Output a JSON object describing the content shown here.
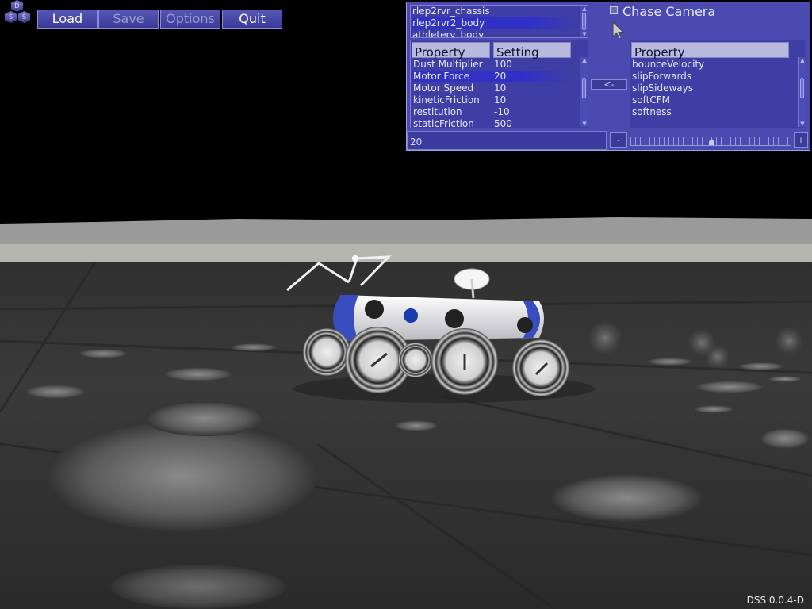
{
  "logo": {
    "letters": [
      "D",
      "S",
      "S"
    ]
  },
  "toolbar": {
    "load": "Load",
    "save": "Save",
    "options": "Options",
    "quit": "Quit"
  },
  "panel": {
    "objects": [
      "rlep2rvr_chassis",
      "rlep2rvr2_body",
      "athleterv_body"
    ],
    "selected_object": "rlep2rvr2_body",
    "chase_camera_label": "Chase Camera",
    "chase_camera_checked": false,
    "left_headers": {
      "property": "Property",
      "setting": "Setting"
    },
    "properties": [
      {
        "name": "Dust Multiplier",
        "value": "100"
      },
      {
        "name": "Motor Force",
        "value": "20"
      },
      {
        "name": "Motor Speed",
        "value": "10"
      },
      {
        "name": "kineticFriction",
        "value": "10"
      },
      {
        "name": "restitution",
        "value": "-10"
      },
      {
        "name": "staticFriction",
        "value": "500"
      }
    ],
    "selected_property": "Motor Force",
    "move_left_button": "<-",
    "right_header": "Property",
    "available_properties": [
      "bounceVelocity",
      "slipForwards",
      "slipSideways",
      "softCFM",
      "softness"
    ],
    "value_field": "20",
    "minus_button": "-",
    "plus_button": "+",
    "slider_fraction": 0.5
  },
  "version": "DSS 0.0.4-D",
  "colors": {
    "panel_bg": "#4a4ab0",
    "list_bg": "#3e3ea4",
    "selection": "#3030c8",
    "header_bg": "#b9b9de"
  }
}
